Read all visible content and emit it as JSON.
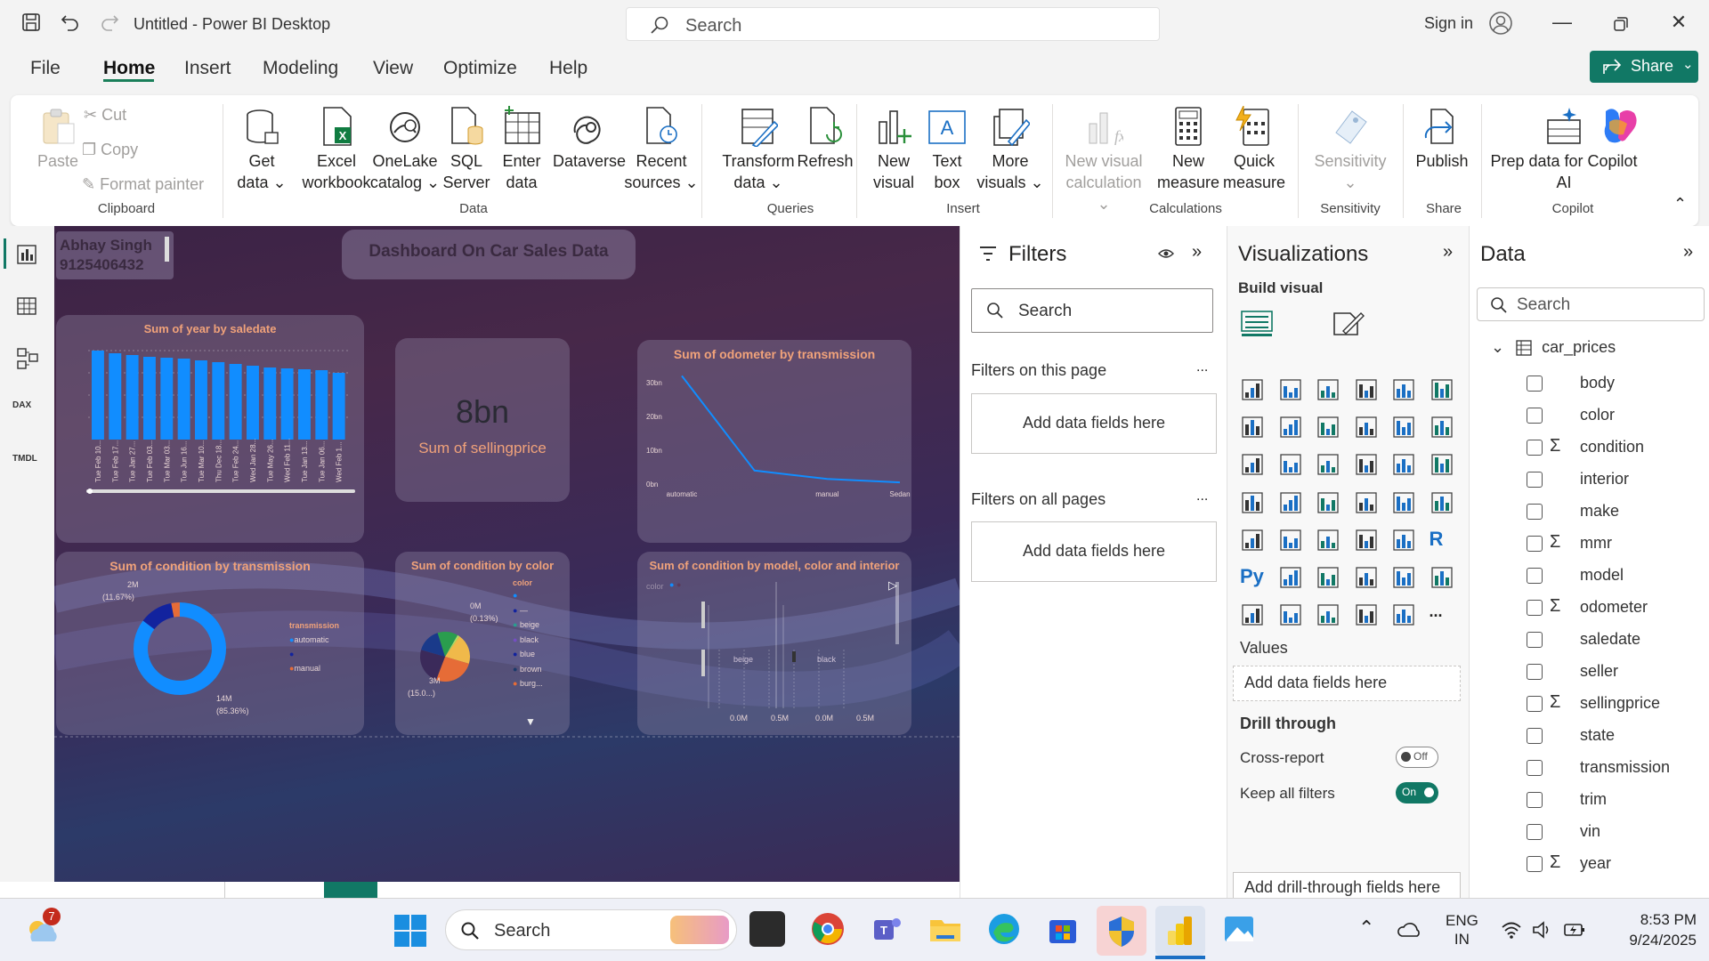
{
  "app": {
    "title": "Untitled - Power BI Desktop",
    "search_placeholder": "Search",
    "sign_in": "Sign in",
    "share": "Share"
  },
  "menu": [
    "File",
    "Home",
    "Insert",
    "Modeling",
    "View",
    "Optimize",
    "Help"
  ],
  "ribbon": {
    "clipboard": {
      "paste": "Paste",
      "cut": "Cut",
      "copy": "Copy",
      "format_painter": "Format painter",
      "group": "Clipboard"
    },
    "data": {
      "get_data_1": "Get",
      "get_data_2": "data",
      "excel_1": "Excel",
      "excel_2": "workbook",
      "onelake_1": "OneLake",
      "onelake_2": "catalog",
      "sql_1": "SQL",
      "sql_2": "Server",
      "enter_1": "Enter",
      "enter_2": "data",
      "dataverse": "Dataverse",
      "recent_1": "Recent",
      "recent_2": "sources",
      "group": "Data"
    },
    "queries": {
      "transform_1": "Transform",
      "transform_2": "data",
      "refresh": "Refresh",
      "group": "Queries"
    },
    "insert": {
      "new_visual_1": "New",
      "new_visual_2": "visual",
      "text_box_1": "Text",
      "text_box_2": "box",
      "more_visuals_1": "More",
      "more_visuals_2": "visuals",
      "group": "Insert"
    },
    "calculations": {
      "new_visual_calc_1": "New visual",
      "new_visual_calc_2": "calculation",
      "new_measure_1": "New",
      "new_measure_2": "measure",
      "quick_measure_1": "Quick",
      "quick_measure_2": "measure",
      "group": "Calculations"
    },
    "sensitivity": {
      "label": "Sensitivity",
      "group": "Sensitivity"
    },
    "share": {
      "publish": "Publish",
      "group": "Share"
    },
    "copilot": {
      "prep_1": "Prep data for Copilot",
      "prep_2": "AI",
      "group": "Copilot"
    }
  },
  "canvas": {
    "author_name": "Abhay Singh",
    "author_phone": "9125406432",
    "dashboard_title": "Dashboard On Car Sales Data",
    "kpi_value": "8bn",
    "kpi_label": "Sum of sellingprice",
    "line_axis_ticks": [
      "30bn",
      "20bn",
      "10bn",
      "0bn"
    ],
    "donut": {
      "legend_title": "transmission",
      "legend": [
        "automatic",
        "",
        "manual"
      ],
      "label_small_1": "2M",
      "label_small_2": "(11.67%)",
      "label_big_1": "14M",
      "label_big_2": "(85.36%)"
    },
    "pie": {
      "legend_title": "color",
      "legend": [
        "",
        "—",
        "beige",
        "black",
        "blue",
        "brown",
        "burg..."
      ],
      "label_top_1": "0M",
      "label_top_2": "(0.13%)",
      "label_bottom_1": "3M",
      "label_bottom_2": "(15.0...)"
    },
    "small_multiples": {
      "legend_label": "color",
      "panels": [
        "beige",
        "black"
      ],
      "x_ticks": [
        "0.0M",
        "0.5M",
        "0.0M",
        "0.5M"
      ]
    }
  },
  "chart_data": [
    {
      "type": "bar",
      "title": "Sum of year by saledate",
      "categories": [
        "Tue Feb 10...",
        "Tue Feb 17...",
        "Tue Jan 27...",
        "Tue Feb 03...",
        "Tue Mar 03...",
        "Tue Jun 16...",
        "Tue Mar 10...",
        "Thu Dec 18...",
        "Tue Feb 24...",
        "Wed Jan 28...",
        "Tue May 26...",
        "Wed Feb 11...",
        "Tue Jan 13...",
        "Tue Jan 06...",
        "Wed Feb 1..."
      ],
      "values": [
        100,
        97,
        95,
        93,
        92,
        91,
        89,
        87,
        85,
        83,
        81,
        80,
        79,
        78,
        75
      ],
      "ylim": [
        0,
        100
      ],
      "grid": true
    },
    {
      "type": "line",
      "title": "Sum of odometer by transmission",
      "categories": [
        "automatic",
        "",
        "manual",
        "Sedan"
      ],
      "values": [
        32,
        4,
        1.5,
        0.5
      ],
      "ylim": [
        0,
        30
      ],
      "yticks": [
        "30bn",
        "20bn",
        "10bn",
        "0bn"
      ]
    },
    {
      "type": "pie",
      "title": "Sum of condition by transmission",
      "categories": [
        "automatic",
        "",
        "manual"
      ],
      "values": [
        85.36,
        11.67,
        2.97
      ]
    },
    {
      "type": "pie",
      "title": "Sum of condition by color",
      "categories": [
        "",
        "—",
        "beige",
        "black",
        "blue",
        "brown",
        "burg..."
      ],
      "values": [
        0.13,
        1,
        15,
        20,
        18,
        12,
        10
      ]
    },
    {
      "type": "bar",
      "title": "Sum of condition by model, color and interior",
      "categories": [
        "beige",
        "black"
      ],
      "values": [
        0,
        0
      ]
    }
  ],
  "filters": {
    "title": "Filters",
    "search_placeholder": "Search",
    "on_this_page": "Filters on this page",
    "on_all_pages": "Filters on all pages",
    "add_fields": "Add data fields here",
    "more": "..."
  },
  "visualizations": {
    "title": "Visualizations",
    "build_visual": "Build visual",
    "values_label": "Values",
    "add_fields": "Add data fields here",
    "drill_through": "Drill through",
    "cross_report": "Cross-report",
    "cross_report_state": "Off",
    "keep_all_filters": "Keep all filters",
    "keep_all_filters_state": "On",
    "add_drill_fields": "Add drill-through fields here",
    "more": "...",
    "icons": [
      "stacked-bar",
      "stacked-column",
      "clustered-bar",
      "clustered-column",
      "100-bar",
      "100-column",
      "line",
      "area",
      "stacked-area",
      "100-area",
      "line-column",
      "line-clustered",
      "ribbon",
      "waterfall",
      "funnel",
      "scatter",
      "pie",
      "donut",
      "treemap",
      "map",
      "filled-map",
      "azure-map",
      "gauge",
      "card",
      "multi-row-card",
      "kpi",
      "slicer",
      "table",
      "matrix",
      "r-visual",
      "python-visual",
      "key-influencers",
      "decomposition-tree",
      "qa",
      "smart-narrative",
      "goals",
      "paginated",
      "power-automate",
      "power-apps",
      "custom",
      "metrics",
      "more"
    ]
  },
  "data_pane": {
    "title": "Data",
    "search_placeholder": "Search",
    "table": "car_prices",
    "fields": [
      {
        "name": "body",
        "sigma": false
      },
      {
        "name": "color",
        "sigma": false
      },
      {
        "name": "condition",
        "sigma": true
      },
      {
        "name": "interior",
        "sigma": false
      },
      {
        "name": "make",
        "sigma": false
      },
      {
        "name": "mmr",
        "sigma": true
      },
      {
        "name": "model",
        "sigma": false
      },
      {
        "name": "odometer",
        "sigma": true
      },
      {
        "name": "saledate",
        "sigma": false
      },
      {
        "name": "seller",
        "sigma": false
      },
      {
        "name": "sellingprice",
        "sigma": true
      },
      {
        "name": "state",
        "sigma": false
      },
      {
        "name": "transmission",
        "sigma": false
      },
      {
        "name": "trim",
        "sigma": false
      },
      {
        "name": "vin",
        "sigma": false
      },
      {
        "name": "year",
        "sigma": true
      }
    ]
  },
  "taskbar": {
    "search_placeholder": "Search",
    "weather_badge": "7",
    "lang_1": "ENG",
    "lang_2": "IN",
    "time": "8:53 PM",
    "date": "9/24/2025"
  },
  "colors": {
    "accent": "#117865",
    "bar_blue": "#118dff",
    "card_title": "#f0a27a"
  }
}
